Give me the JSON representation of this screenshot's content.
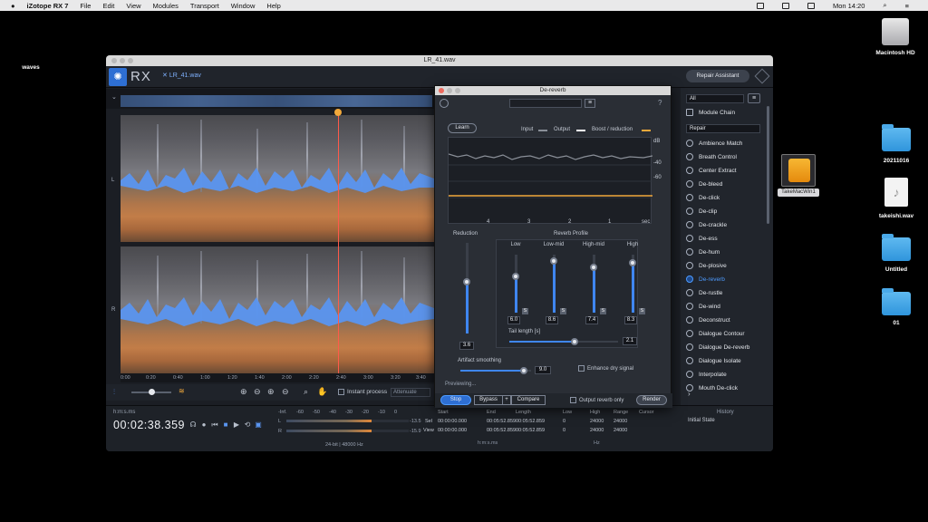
{
  "menubar": {
    "app": "iZotope RX 7",
    "items": [
      "File",
      "Edit",
      "View",
      "Modules",
      "Transport",
      "Window",
      "Help"
    ],
    "clock": "Mon 14:20"
  },
  "desktop": {
    "waves": "waves",
    "hd": "Macintosh HD",
    "drive": "TakeMacWin1",
    "folder1": "20211016",
    "wav": "takeishi.wav",
    "folder2": "Untitled",
    "folder3": "01"
  },
  "window": {
    "title": "LR_41.wav"
  },
  "toolbar": {
    "logo_text": "RX",
    "file_tab": "LR_41.wav",
    "repair_assistant": "Repair Assistant"
  },
  "channels": {
    "left": "L",
    "right": "R"
  },
  "ruler": [
    "0:00",
    "0:20",
    "0:40",
    "1:00",
    "1:20",
    "1:40",
    "2:00",
    "2:20",
    "2:40",
    "3:00",
    "3:20",
    "3:40"
  ],
  "bottom_tools": {
    "instant_process": "Instant process",
    "mode": "Attenuate"
  },
  "transport": {
    "time_format": "h:m:s.ms",
    "time": "00:02:38.359",
    "meter_scale": [
      "-Inf.",
      "-60",
      "-50",
      "-40",
      "-30",
      "-20",
      "-10",
      "0"
    ],
    "meter_L": "-13.5",
    "meter_R": "-15.9",
    "meter_info": "24-bit | 48000 Hz",
    "sel_headers": [
      "Start",
      "End",
      "Length",
      "Low",
      "High",
      "Range",
      "Cursor"
    ],
    "sel_row": [
      "Sel",
      "00:00:00.000",
      "00:05:52.859",
      "00:05:52.859",
      "0",
      "24000",
      "24000"
    ],
    "view_row": [
      "View",
      "00:00:00.000",
      "00:05:52.859",
      "00:05:52.859",
      "0",
      "24000",
      "24000"
    ],
    "time_unit": "h:m:s.ms",
    "hz_unit": "Hz"
  },
  "right_panel": {
    "filter": "All",
    "module_chain": "Module Chain",
    "category": "Repair",
    "modules": [
      "Ambience Match",
      "Breath Control",
      "Center Extract",
      "De-bleed",
      "De-click",
      "De-clip",
      "De-crackle",
      "De-ess",
      "De-hum",
      "De-plosive",
      "De-reverb",
      "De-rustle",
      "De-wind",
      "Deconstruct",
      "Dialogue Contour",
      "Dialogue De-reverb",
      "Dialogue Isolate",
      "Interpolate",
      "Mouth De-click"
    ],
    "selected_index": 10
  },
  "history": {
    "title": "History",
    "item": "Initial State"
  },
  "dereverb": {
    "title": "De-reverb",
    "learn": "Learn",
    "legend_input": "Input",
    "legend_output": "Output",
    "legend_boost": "Boost / reduction",
    "db_ticks": [
      "dB",
      "-40",
      "-60"
    ],
    "x_ticks": [
      "4",
      "3",
      "2",
      "1",
      "sec"
    ],
    "reduction_label": "Reduction",
    "reduction_value": "3.6",
    "reduction_level": 0.57,
    "profile_label": "Reverb Profile",
    "bands": [
      {
        "name": "Low",
        "value": "6.0",
        "level": 0.62
      },
      {
        "name": "Low-mid",
        "value": "8.6",
        "level": 0.89
      },
      {
        "name": "High-mid",
        "value": "7.4",
        "level": 0.78
      },
      {
        "name": "High",
        "value": "8.3",
        "level": 0.86
      }
    ],
    "solo_label": "S",
    "tail_label": "Tail length [s]",
    "tail_value": "2.1",
    "tail_level": 0.6,
    "smoothing_label": "Artifact smoothing",
    "smoothing_value": "9.0",
    "smoothing_level": 0.9,
    "enhance_label": "Enhance dry signal",
    "previewing": "Previewing...",
    "stop": "Stop",
    "bypass": "Bypass",
    "plus": "+",
    "compare": "Compare",
    "output_only": "Output reverb only",
    "render": "Render"
  },
  "colors": {
    "accent": "#3f86f0",
    "playhead": "#ff5a4a",
    "boost": "#f2a93b"
  }
}
